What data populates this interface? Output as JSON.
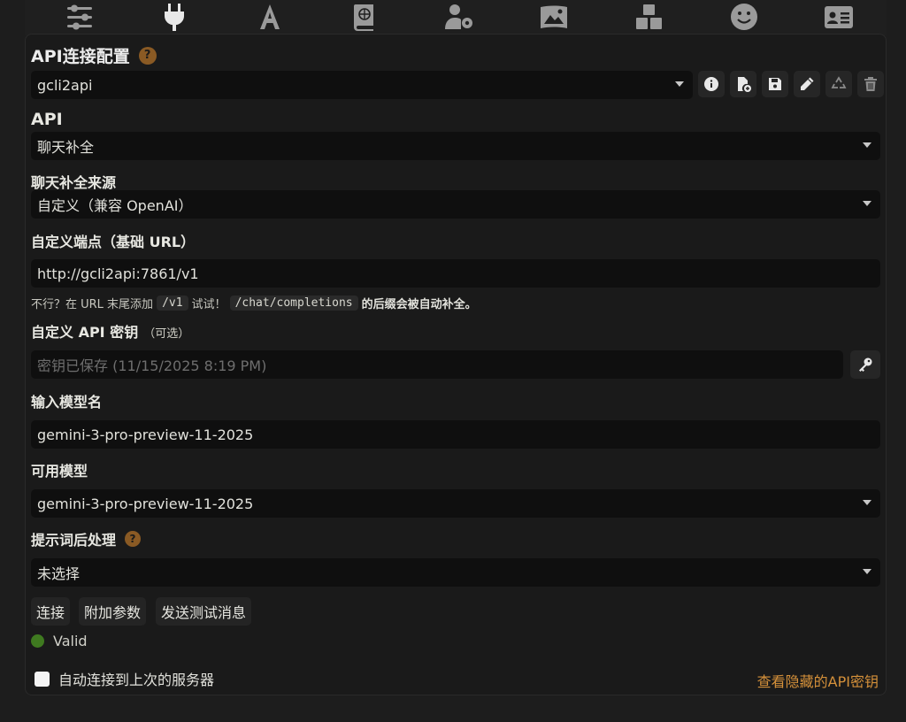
{
  "topbar": {
    "icons": [
      "sliders-icon",
      "plug-icon",
      "font-icon",
      "book-atlas-icon",
      "user-gear-icon",
      "image-icon",
      "cubes-icon",
      "smile-icon",
      "id-card-icon"
    ]
  },
  "api_connection": {
    "title": "API连接配置",
    "help": "?",
    "profile_value": "gcli2api"
  },
  "api": {
    "label": "API",
    "value": "聊天补全"
  },
  "source": {
    "label": "聊天补全来源",
    "value": "自定义（兼容 OpenAI）"
  },
  "endpoint": {
    "label": "自定义端点（基础 URL）",
    "value": "http://gcli2api:7861/v1",
    "hint_prefix": "不行？在 URL 末尾添加",
    "hint_code1": "/v1",
    "hint_mid": "试试！",
    "hint_code2": "/chat/completions",
    "hint_suffix": "的后缀会被自动补全。"
  },
  "api_key": {
    "label": "自定义 API 密钥",
    "optional": "（可选）",
    "placeholder": "密钥已保存 (11/15/2025 8:19 PM)"
  },
  "model_input": {
    "label": "输入模型名",
    "value": "gemini-3-pro-preview-11-2025"
  },
  "available_models": {
    "label": "可用模型",
    "value": "gemini-3-pro-preview-11-2025"
  },
  "postprocess": {
    "label": "提示词后处理",
    "help": "?",
    "value": "未选择"
  },
  "buttons": {
    "connect": "连接",
    "extra_params": "附加参数",
    "send_test": "发送测试消息"
  },
  "status": {
    "text": "Valid",
    "color": "#3f7a20"
  },
  "auto_connect": {
    "label": "自动连接到上次的服务器",
    "checked": false
  },
  "hidden_keys_link": "查看隐藏的API密钥",
  "colors": {
    "accent_link": "#d4903a",
    "help_badge": "#8a5a24",
    "background": "#1d1d1d"
  }
}
